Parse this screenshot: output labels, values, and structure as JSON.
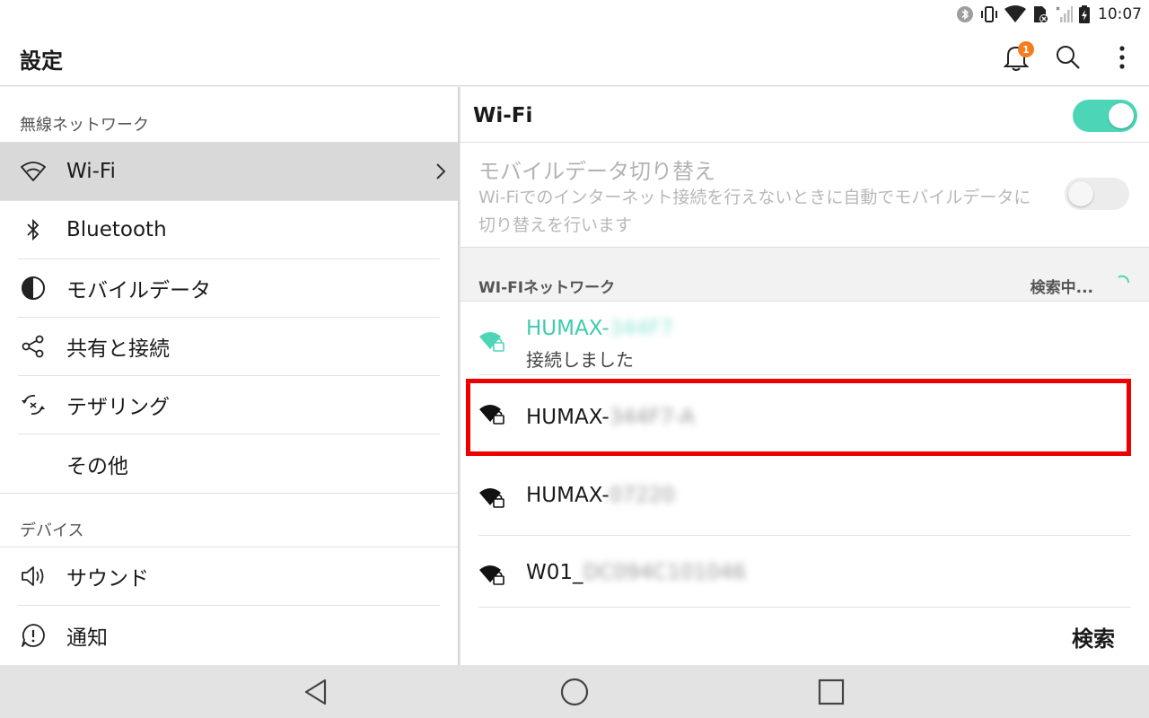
{
  "status_bar": {
    "time": "10:07",
    "icons": [
      "bluetooth-icon",
      "vibrate-icon",
      "wifi-signal-icon",
      "sim-alert-icon",
      "cell-signal-icon",
      "battery-charging-icon"
    ]
  },
  "action_bar": {
    "title": "設定",
    "notification_count": "1",
    "icons": [
      "bell-icon",
      "search-icon",
      "more-vert-icon"
    ]
  },
  "sidebar": {
    "section_wireless": "無線ネットワーク",
    "items": [
      {
        "label": "Wi-Fi",
        "icon": "wifi-icon",
        "selected": true
      },
      {
        "label": "Bluetooth",
        "icon": "bluetooth-icon"
      },
      {
        "label": "モバイルデータ",
        "icon": "data-usage-icon"
      },
      {
        "label": "共有と接続",
        "icon": "share-icon"
      },
      {
        "label": "テザリング",
        "icon": "tethering-icon"
      },
      {
        "label": "その他",
        "icon": ""
      }
    ],
    "section_device": "デバイス",
    "device_items": [
      {
        "label": "サウンド",
        "icon": "speaker-icon"
      },
      {
        "label": "通知",
        "icon": "notification-alert-icon"
      }
    ]
  },
  "wifi_panel": {
    "title": "Wi-Fi",
    "wifi_enabled": true,
    "mobile_switch": {
      "title": "モバイルデータ切り替え",
      "description": "Wi-Fiでのインターネット接続を行えないときに自動でモバイルデータに切り替えを行います",
      "enabled": false
    },
    "networks_header": "WI-FIネットワーク",
    "scan_status": "検索中...",
    "networks": [
      {
        "name_prefix": "HUMAX-",
        "name_hidden": "344F7",
        "status": "接続しました",
        "connected": true
      },
      {
        "name_prefix": "HUMAX-",
        "name_hidden": "344F7-A",
        "highlighted": true
      },
      {
        "name_prefix": "HUMAX-",
        "name_hidden": "07220"
      },
      {
        "name_prefix": "W01_",
        "name_hidden": "DC094C101046"
      }
    ],
    "search_button": "検索"
  },
  "colors": {
    "accent": "#4dd5b8",
    "connected_text": "#3ecbb0",
    "highlight_border": "#ee0000",
    "badge": "#f57c1f"
  },
  "nav_bar": {
    "icons": [
      "back-icon",
      "home-icon",
      "recents-icon"
    ]
  }
}
